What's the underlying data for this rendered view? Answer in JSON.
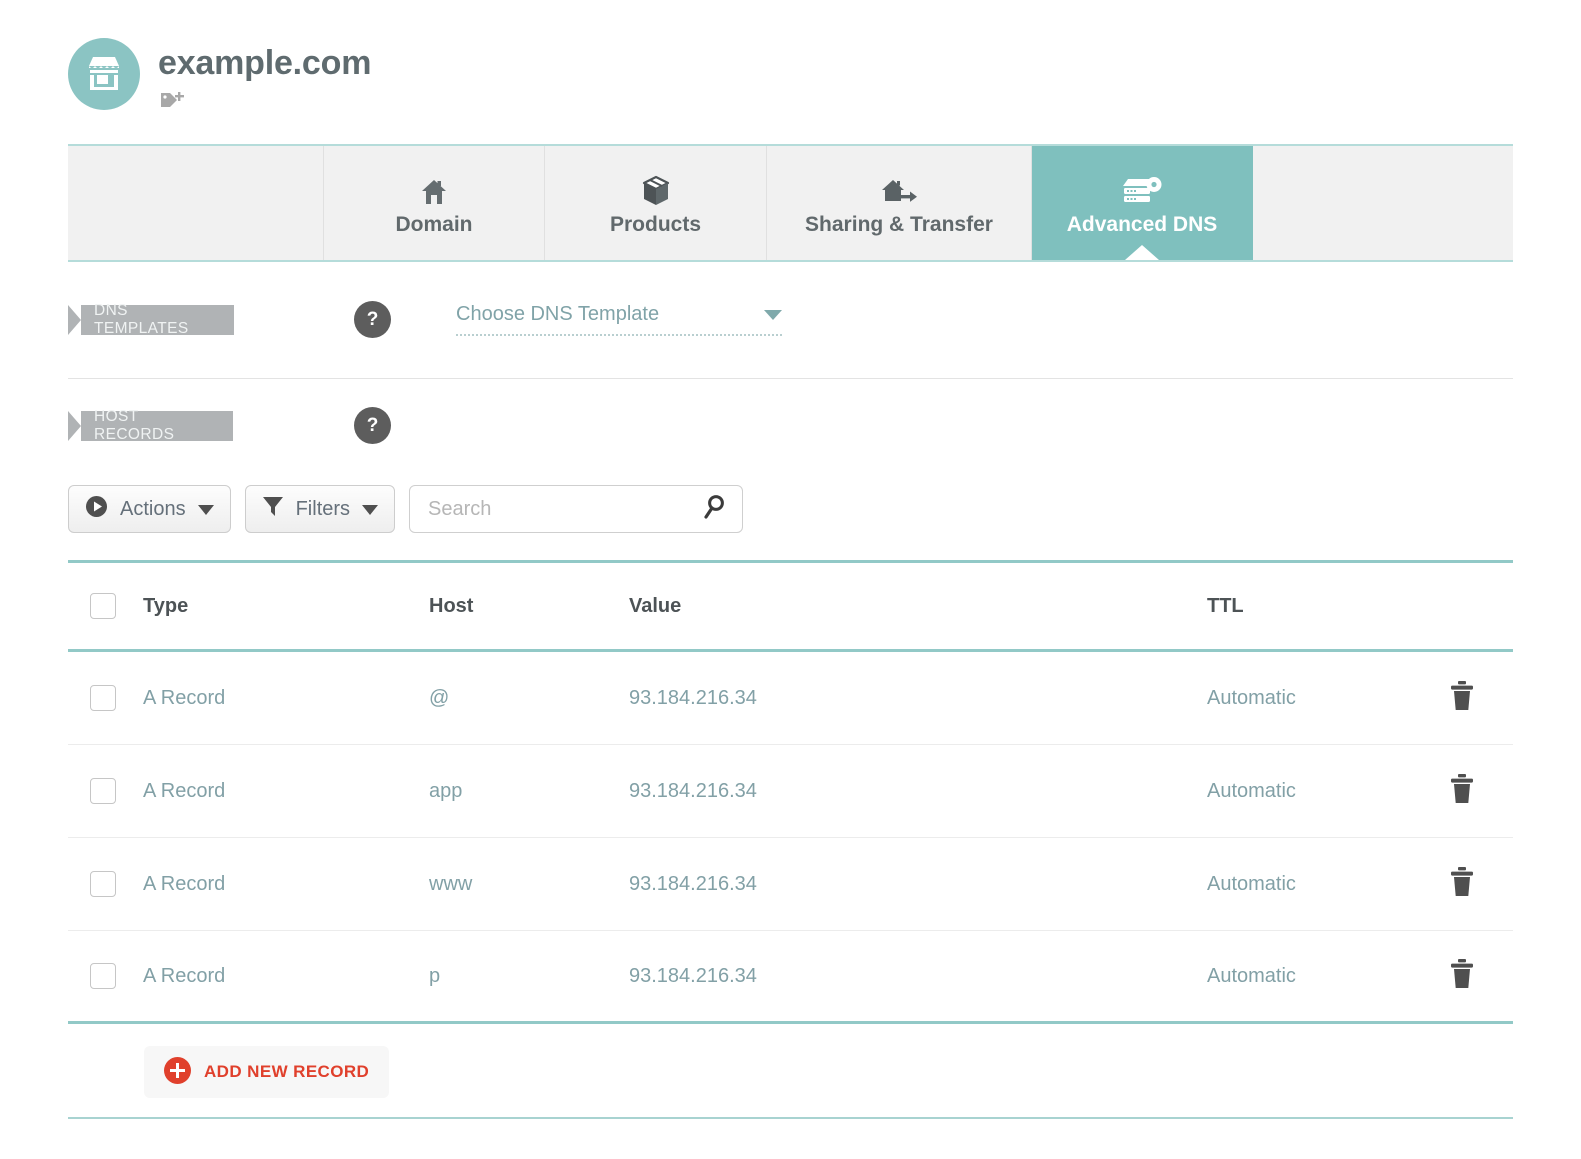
{
  "header": {
    "domain_title": "example.com",
    "avatar_icon": "storefront-icon",
    "tag_icon": "tag-add-icon",
    "accent_color": "#7fc0be"
  },
  "tabs": [
    {
      "label": "Domain",
      "icon": "home-icon",
      "active": false
    },
    {
      "label": "Products",
      "icon": "box-icon",
      "active": false
    },
    {
      "label": "Sharing & Transfer",
      "icon": "home-transfer-icon",
      "active": false
    },
    {
      "label": "Advanced DNS",
      "icon": "server-gear-icon",
      "active": true
    }
  ],
  "dns_templates": {
    "ribbon_label": "DNS TEMPLATES",
    "help_label": "?",
    "select_value": "Choose DNS Template"
  },
  "host_records": {
    "ribbon_label": "HOST RECORDS",
    "help_label": "?"
  },
  "toolbar": {
    "actions_label": "Actions",
    "filters_label": "Filters",
    "search_placeholder": "Search",
    "search_value": ""
  },
  "table": {
    "columns": [
      "Type",
      "Host",
      "Value",
      "TTL"
    ],
    "rows": [
      {
        "type": "A Record",
        "host": "@",
        "value": "93.184.216.34",
        "ttl": "Automatic"
      },
      {
        "type": "A Record",
        "host": "app",
        "value": "93.184.216.34",
        "ttl": "Automatic"
      },
      {
        "type": "A Record",
        "host": "www",
        "value": "93.184.216.34",
        "ttl": "Automatic"
      },
      {
        "type": "A Record",
        "host": "p",
        "value": "93.184.216.34",
        "ttl": "Automatic"
      }
    ]
  },
  "add_record": {
    "label": "ADD NEW RECORD",
    "icon": "plus-circle-icon",
    "color": "#e0402c"
  }
}
